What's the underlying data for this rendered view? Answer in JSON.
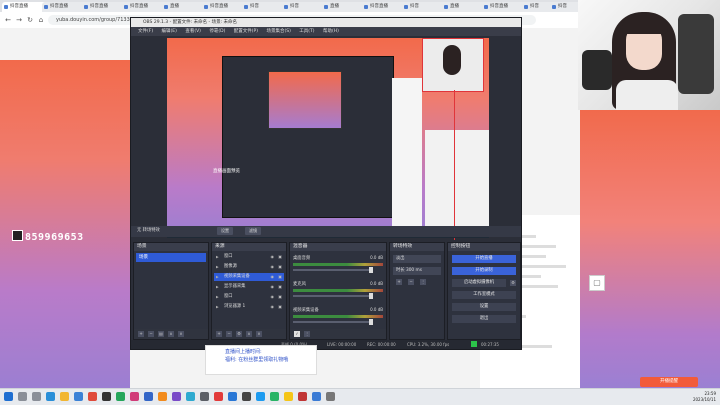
{
  "browser": {
    "tabs": [
      "抖音直播",
      "抖音直播",
      "抖音直播",
      "抖音直播",
      "直播",
      "抖音直播",
      "抖音",
      "抖音",
      "直播",
      "抖音直播",
      "抖音",
      "直播",
      "抖音直播",
      "抖音",
      "抖音"
    ],
    "url": "yuba.douyin.com/group/7133..."
  },
  "stream": {
    "id_number": "859969653"
  },
  "obs": {
    "title": "OBS 29.1.3 - 配置文件: 未命名 - 场景: 未命名",
    "menu": [
      "文件(F)",
      "编辑(E)",
      "查看(V)",
      "停靠(D)",
      "配置文件(P)",
      "场景集合(S)",
      "工具(T)",
      "帮助(H)"
    ],
    "preview_label": "直播画面预览",
    "scene_bar": {
      "label": "无 转场特效",
      "buttons": [
        "设置",
        "滤镜"
      ]
    },
    "docks": {
      "scenes": {
        "title": "场景",
        "items": [
          "场景"
        ]
      },
      "sources": {
        "title": "来源",
        "items": [
          "窗口",
          "图像源",
          "视频采集设备",
          "显示器采集",
          "窗口",
          "浏览器源 1"
        ]
      },
      "mixer": {
        "title": "混音器",
        "channels": [
          {
            "name": "桌面音频",
            "db": "0.0 dB"
          },
          {
            "name": "麦克风",
            "db": "0.0 dB"
          },
          {
            "name": "视频采集设备",
            "db": "0.0 dB"
          }
        ]
      },
      "transitions": {
        "title": "转场特效",
        "rows": [
          "淡出",
          "时长 300 ms"
        ]
      },
      "controls": {
        "title": "控制按钮",
        "buttons": [
          "开始直播",
          "开始录制",
          "启动虚拟摄像机",
          "工作室模式",
          "设置",
          "退出"
        ]
      }
    },
    "status": [
      "丢帧 0 (0.0%)",
      "LIVE: 00:00:00",
      "REC: 00:00:00",
      "CPU: 3.2%, 30.00 fps",
      "00:27:35"
    ]
  },
  "page": {
    "below_text1": "直播间上播时间:",
    "below_text2": "福利: 在粉丝群里领取礼物哦",
    "red_button": "开播提醒"
  },
  "taskbar": {
    "time": "23:59",
    "date": "2023/10/11"
  }
}
